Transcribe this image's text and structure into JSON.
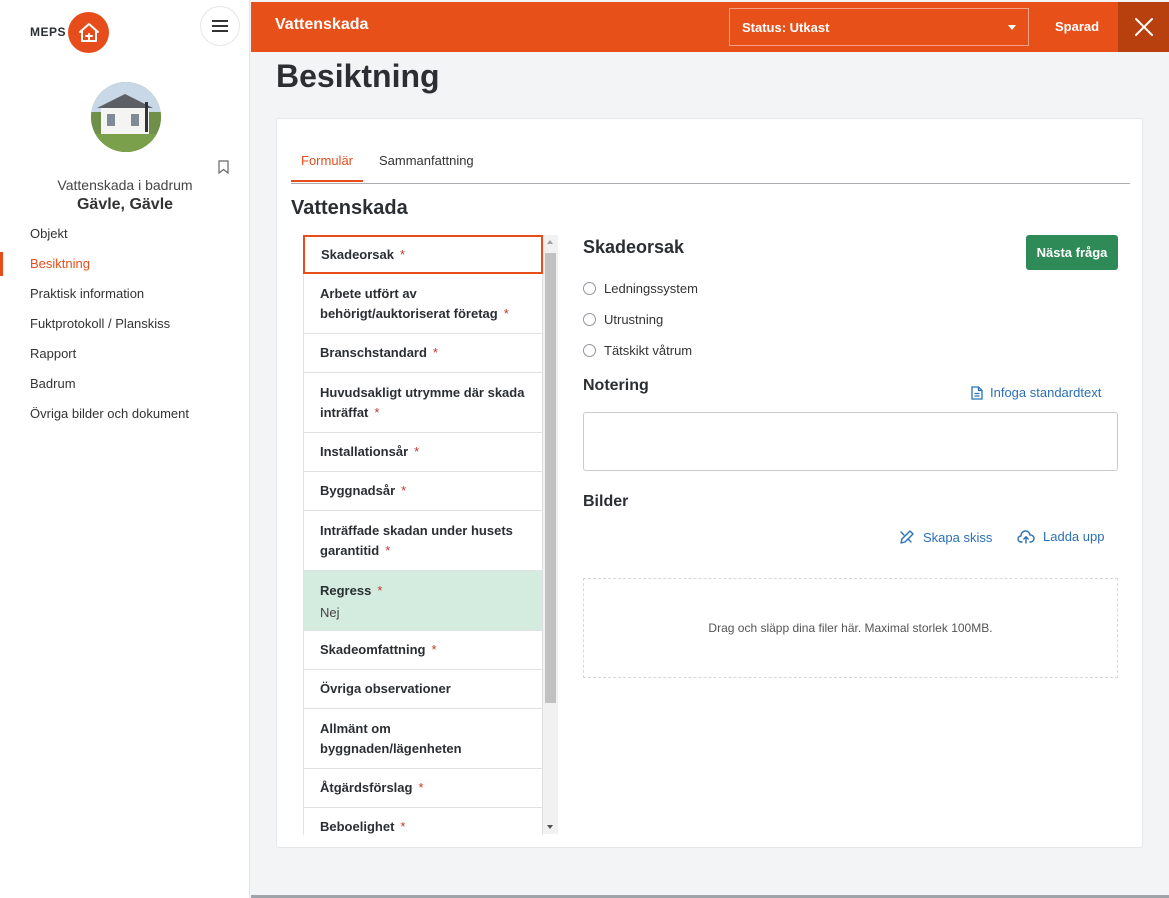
{
  "brand": {
    "logo_text": "MEPS",
    "accent": "#e8501a"
  },
  "sidebar": {
    "case_title": "Vattenskada i badrum",
    "case_location": "Gävle, Gävle",
    "nav": [
      {
        "label": "Objekt",
        "active": false
      },
      {
        "label": "Besiktning",
        "active": true
      },
      {
        "label": "Praktisk information",
        "active": false
      },
      {
        "label": "Fuktprotokoll / Planskiss",
        "active": false
      },
      {
        "label": "Rapport",
        "active": false
      },
      {
        "label": "Badrum",
        "active": false
      },
      {
        "label": "Övriga bilder och dokument",
        "active": false
      }
    ]
  },
  "header": {
    "title": "Vattenskada",
    "status": "Status: Utkast",
    "saved": "Sparad"
  },
  "page": {
    "title": "Besiktning"
  },
  "tabs": [
    {
      "label": "Formulär",
      "active": true
    },
    {
      "label": "Sammanfattning",
      "active": false
    }
  ],
  "form": {
    "title": "Vattenskada",
    "questions": [
      {
        "lines": [
          "Skadeorsak"
        ],
        "required": true,
        "answer": "",
        "state": "active"
      },
      {
        "lines": [
          "Arbete utfört av",
          "behörigt/auktoriserat företag"
        ],
        "required": true,
        "answer": "",
        "state": ""
      },
      {
        "lines": [
          "Branschstandard"
        ],
        "required": true,
        "answer": "",
        "state": ""
      },
      {
        "lines": [
          "Huvudsakligt utrymme där skada",
          "inträffat"
        ],
        "required": true,
        "answer": "",
        "state": ""
      },
      {
        "lines": [
          "Installationsår"
        ],
        "required": true,
        "answer": "",
        "state": ""
      },
      {
        "lines": [
          "Byggnadsår"
        ],
        "required": true,
        "answer": "",
        "state": ""
      },
      {
        "lines": [
          "Inträffade skadan under husets",
          "garantitid"
        ],
        "required": true,
        "answer": "",
        "state": ""
      },
      {
        "lines": [
          "Regress"
        ],
        "required": true,
        "answer": "Nej",
        "state": "answered"
      },
      {
        "lines": [
          "Skadeomfattning"
        ],
        "required": true,
        "answer": "",
        "state": ""
      },
      {
        "lines": [
          "Övriga observationer"
        ],
        "required": false,
        "answer": "",
        "state": ""
      },
      {
        "lines": [
          "Allmänt om",
          "byggnaden/lägenheten"
        ],
        "required": false,
        "answer": "",
        "state": ""
      },
      {
        "lines": [
          "Åtgärdsförslag"
        ],
        "required": true,
        "answer": "",
        "state": ""
      },
      {
        "lines": [
          "Beboelighet"
        ],
        "required": true,
        "answer": "",
        "state": ""
      }
    ],
    "required_marker": "*"
  },
  "detail": {
    "heading": "Skadeorsak",
    "next_button": "Nästa fråga",
    "options": [
      "Ledningssystem",
      "Utrustning",
      "Tätskikt våtrum"
    ],
    "note_label": "Notering",
    "insert_standard_text": "Infoga standardtext",
    "images_label": "Bilder",
    "create_sketch": "Skapa skiss",
    "upload": "Ladda upp",
    "dropzone_text": "Drag och släpp dina filer här. Maximal storlek 100MB."
  },
  "colors": {
    "next_button": "#2e8b57",
    "link": "#2a70b8",
    "answered_bg": "#d4ebdf",
    "required": "#c0392b"
  }
}
